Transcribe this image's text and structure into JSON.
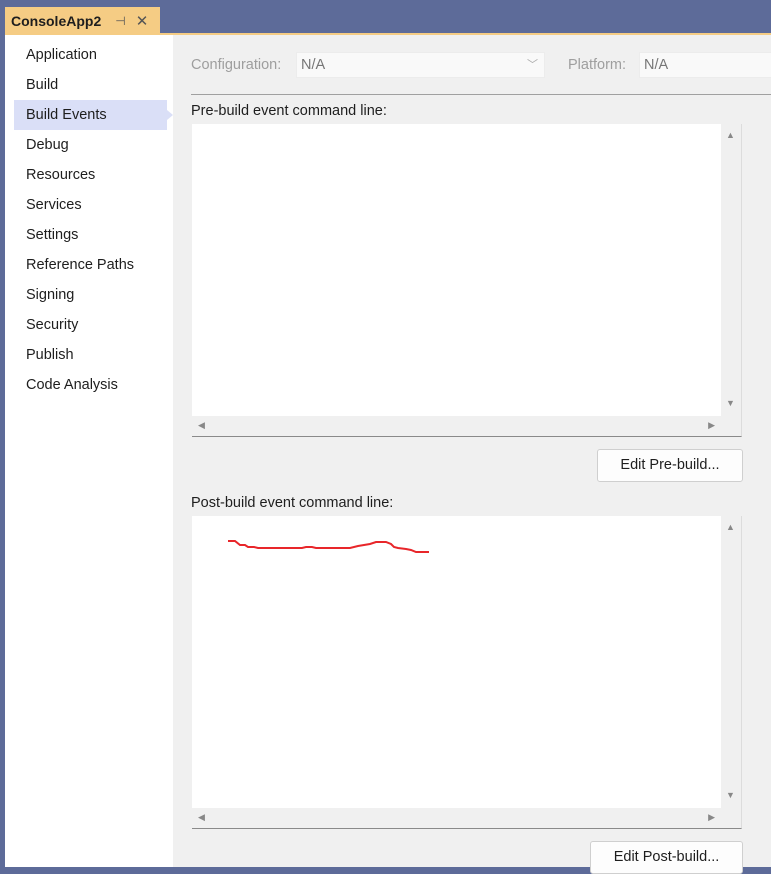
{
  "tab": {
    "title": "ConsoleApp2",
    "pin_icon": "⊣",
    "close_icon": "✕"
  },
  "sidebar": {
    "items": [
      {
        "label": "Application",
        "active": false
      },
      {
        "label": "Build",
        "active": false
      },
      {
        "label": "Build Events",
        "active": true
      },
      {
        "label": "Debug",
        "active": false
      },
      {
        "label": "Resources",
        "active": false
      },
      {
        "label": "Services",
        "active": false
      },
      {
        "label": "Settings",
        "active": false
      },
      {
        "label": "Reference Paths",
        "active": false
      },
      {
        "label": "Signing",
        "active": false
      },
      {
        "label": "Security",
        "active": false
      },
      {
        "label": "Publish",
        "active": false
      },
      {
        "label": "Code Analysis",
        "active": false
      }
    ]
  },
  "toolbar": {
    "configuration_label": "Configuration:",
    "configuration_value": "N/A",
    "platform_label": "Platform:",
    "platform_value": "N/A",
    "chevron_icon": "﹀"
  },
  "prebuild": {
    "label": "Pre-build event command line:",
    "value": "",
    "button": "Edit Pre-build..."
  },
  "postbuild": {
    "label": "Post-build event command line:",
    "value": "",
    "button": "Edit Post-build...",
    "annotation_color": "#e8262a"
  },
  "scroll_icons": {
    "up": "▲",
    "down": "▼",
    "left": "◀",
    "right": "▶"
  }
}
